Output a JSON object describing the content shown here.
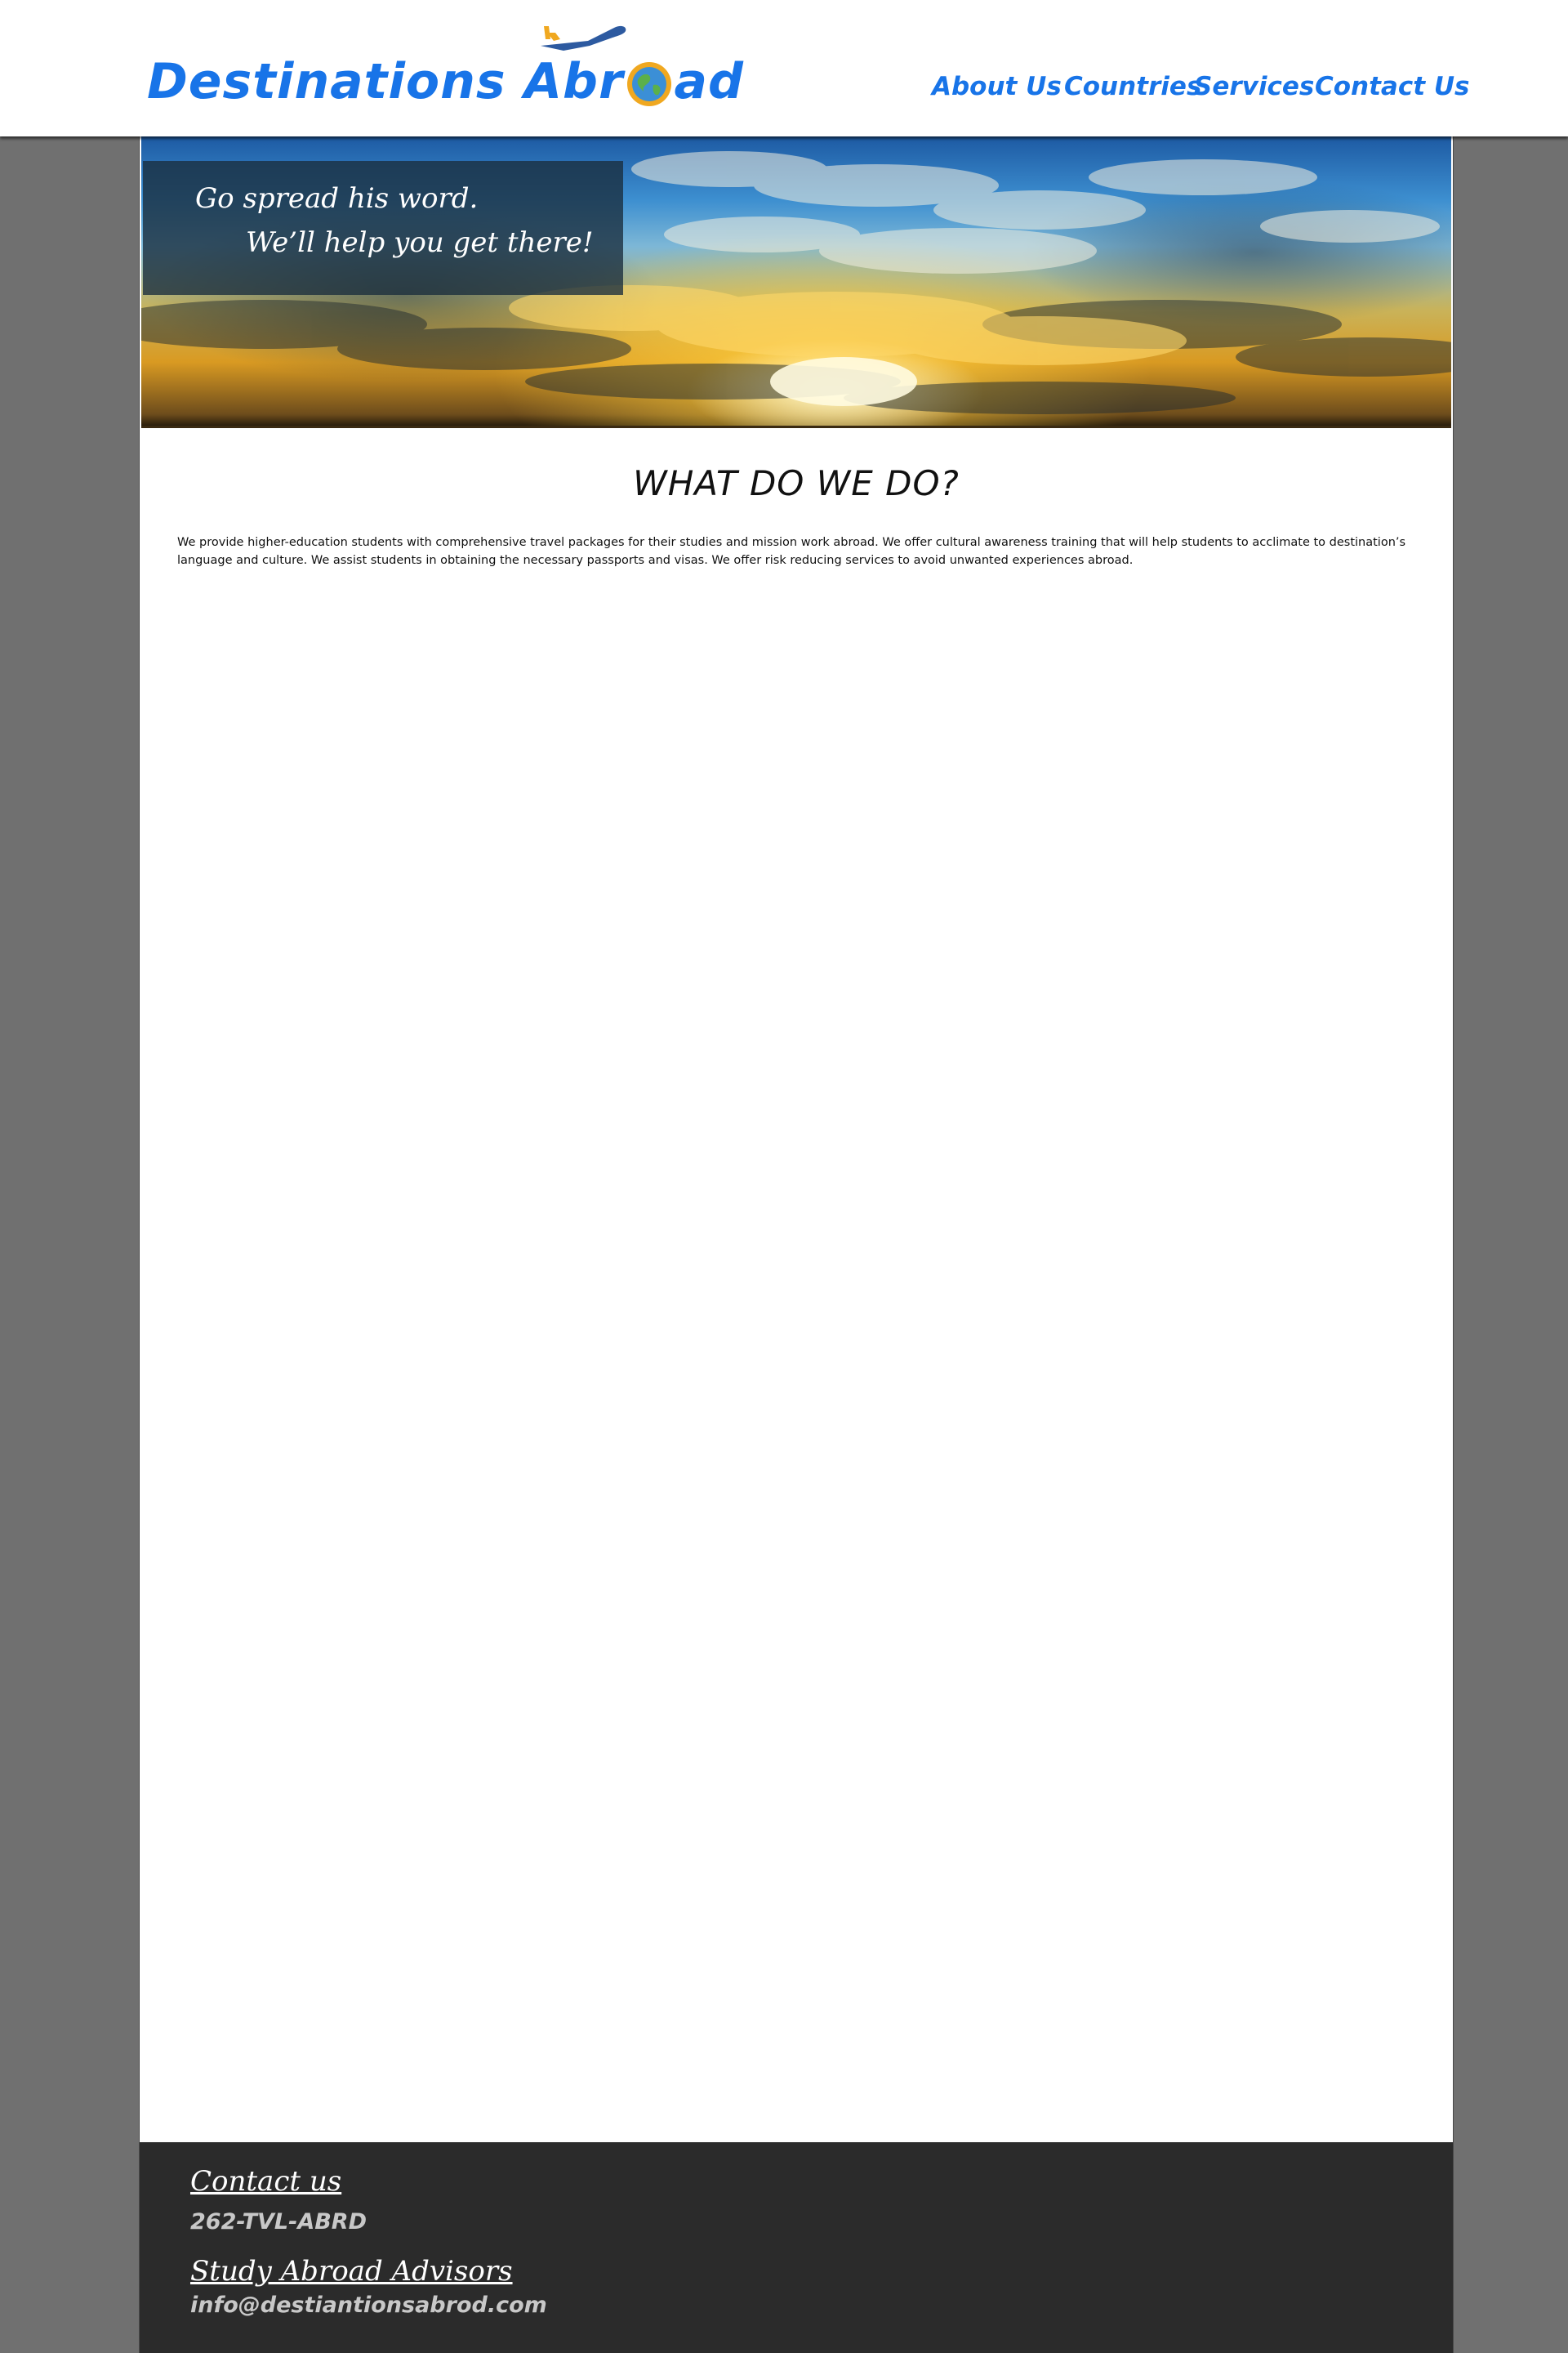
{
  "brand": {
    "name_left": "Destinations",
    "name_right_a": "Abr",
    "name_right_b": "ad",
    "color": "#1874e8",
    "globe_icon": "globe-icon",
    "plane_icon": "airplane-icon"
  },
  "nav": {
    "items": [
      {
        "label": "About Us"
      },
      {
        "label": "Countries"
      },
      {
        "label": "Services"
      },
      {
        "label": "Contact Us"
      }
    ]
  },
  "hero": {
    "line1": "Go spread his word.",
    "line2": "We’ll help you get there!"
  },
  "main": {
    "title": "WHAT DO WE DO?",
    "body": "We provide higher-education students with comprehensive travel packages for their studies and mission work abroad.  We offer cultural awareness training that will help students to acclimate to destination’s language and culture.  We assist students in obtaining the necessary passports and visas.   We offer risk reducing services to avoid unwanted experiences abroad."
  },
  "footer": {
    "contact_heading": "Contact us",
    "phone": "262-TVL-ABRD",
    "advisors_heading": "Study Abroad Advisors",
    "email": "info@destiantionsabrod.com"
  }
}
